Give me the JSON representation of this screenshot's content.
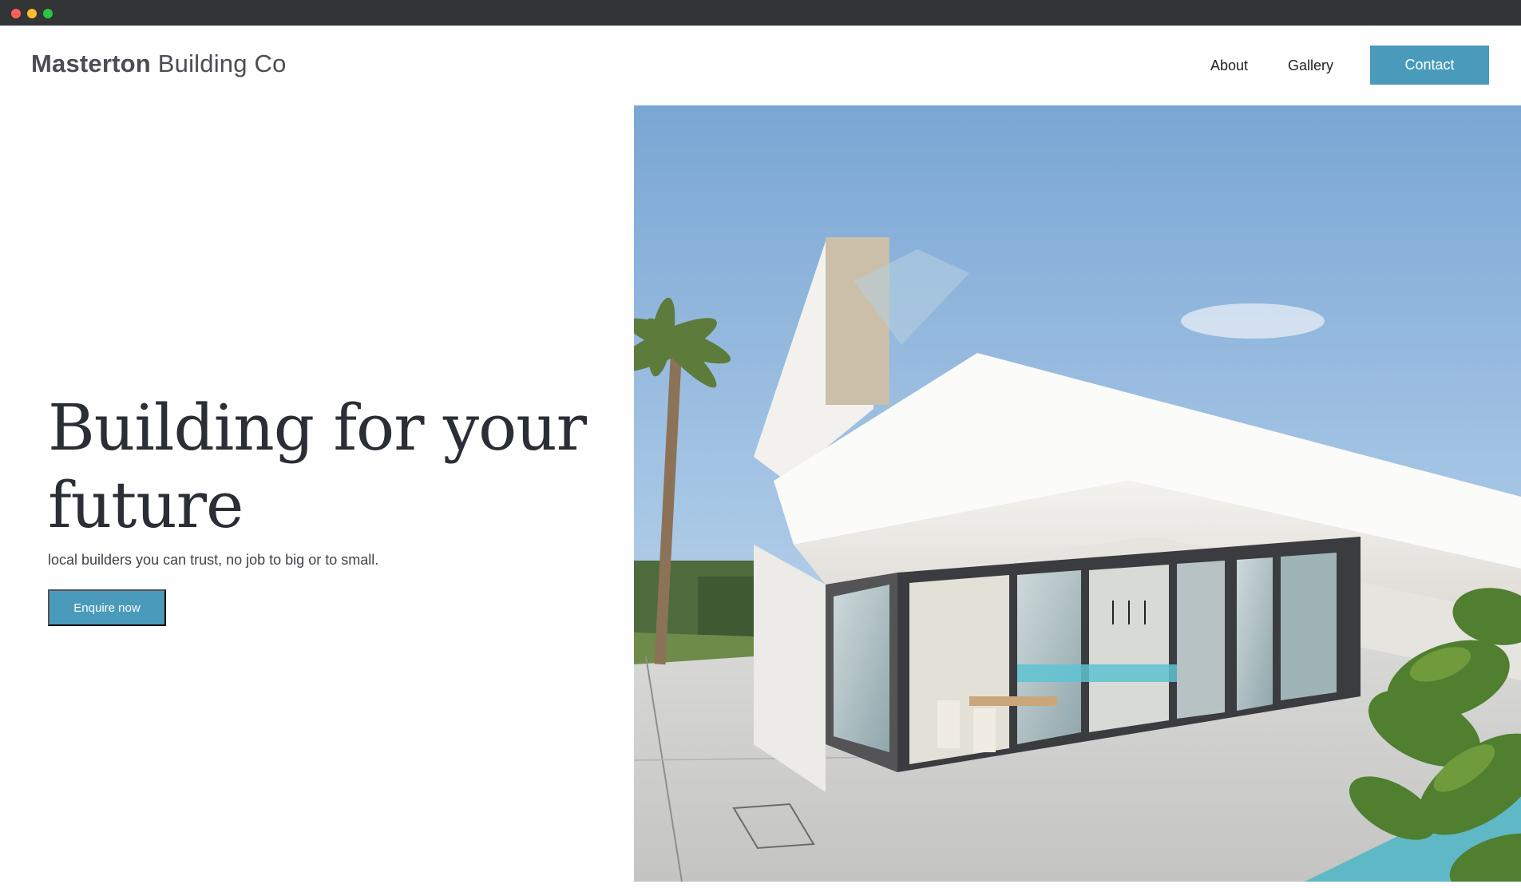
{
  "header": {
    "brand_bold": "Masterton",
    "brand_rest": "Building Co",
    "nav": {
      "about": "About",
      "gallery": "Gallery",
      "contact": "Contact"
    }
  },
  "hero": {
    "title_line1": "Building for your",
    "title_line2": "future",
    "subtitle": "local builders you can trust, no job to big or to small.",
    "cta": "Enquire now"
  },
  "colors": {
    "accent": "#4a9bbb",
    "text_dark": "#2b2e35",
    "titlebar": "#323436"
  },
  "icons": {
    "traffic_close": "red-dot",
    "traffic_minimize": "yellow-dot",
    "traffic_zoom": "green-dot"
  }
}
